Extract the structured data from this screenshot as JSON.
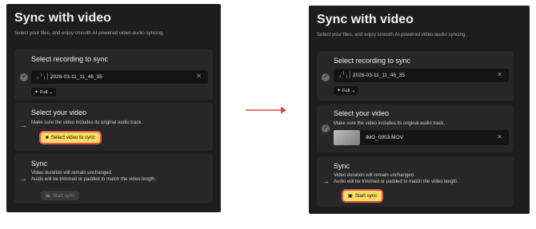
{
  "title": "Sync with video",
  "subtitle": "Select your files, and enjoy smooth AI-powered video-audio syncing.",
  "recording": {
    "heading": "Select recording to sync",
    "file_name": "2026-03-11_11_46_35",
    "mode": "Full"
  },
  "video": {
    "heading": "Select your video",
    "description": "Make sure the video includes its original audio track.",
    "select_button": "Select video to sync",
    "file_name": "IMG_0953.MOV"
  },
  "sync": {
    "heading": "Sync",
    "line1": "Video duration will remain unchanged.",
    "line2": "Audio will be trimmed or padded to match the video length.",
    "button": "Start sync"
  },
  "colors": {
    "accent_yellow": "#f6dc5f",
    "highlight_red": "#e9554f",
    "panel": "#1d1d1d"
  }
}
